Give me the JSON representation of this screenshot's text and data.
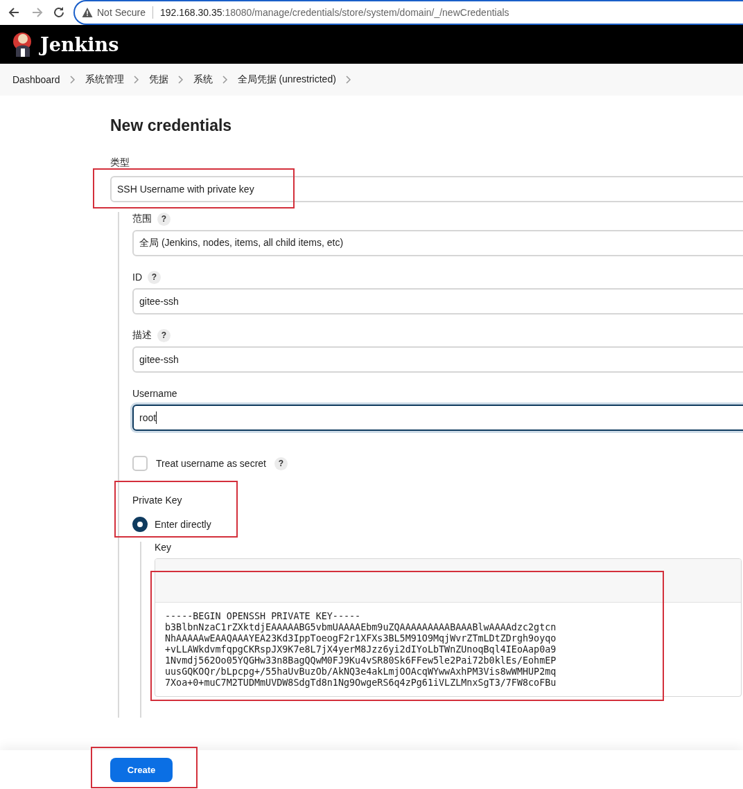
{
  "browser": {
    "security": "Not Secure",
    "url_host": "192.168.30.35",
    "url_path": ":18080/manage/credentials/store/system/domain/_/newCredentials"
  },
  "header": {
    "title": "Jenkins"
  },
  "breadcrumbs": [
    "Dashboard",
    "系统管理",
    "凭据",
    "系统",
    "全局凭据 (unrestricted)"
  ],
  "page_title": "New credentials",
  "kind_field": {
    "label": "类型",
    "value": "SSH Username with private key",
    "highlighted": true
  },
  "fields": [
    {
      "label": "范围",
      "help": "?",
      "value": "全局 (Jenkins, nodes, items, all child items, etc)",
      "focused": false
    },
    {
      "label": "ID",
      "help": "?",
      "value": "gitee-ssh",
      "focused": false
    },
    {
      "label": "描述",
      "help": "?",
      "value": "gitee-ssh",
      "focused": false
    },
    {
      "label": "Username",
      "value": "root",
      "focused": true
    }
  ],
  "secret_checkbox": {
    "label": "Treat username as secret",
    "help": "?",
    "checked": false
  },
  "private_key": {
    "label": "Private Key",
    "highlighted": true,
    "options": [
      {
        "label": "Enter directly",
        "selected": true
      }
    ],
    "key": {
      "label": "Key",
      "highlighted": true,
      "value": "-----BEGIN OPENSSH PRIVATE KEY-----\nb3BlbnNzaC1rZXktdjEAAAAABG5vbmUAAAAEbm9uZQAAAAAAAAABAAABlwAAAAdzc2gtcn\nNhAAAAAwEAAQAAAYEA23Kd3IppToeogF2r1XFXs3BL5M91O9MqjWvrZTmLDtZDrgh9oyqo\n+vLLAWkdvmfqpgCKRspJX9K7e8L7jX4yerM8Jzz6yi2dIYoLbTWnZUnoqBql4IEoAap0a9\n1Nvmdj562Oo05YQGHw33n8BagQQwM0FJ9Ku4vSR80Sk6FFew5le2Pai72b0klEs/EohmEP\nuusGQKOQr/bLpcpg+/55haUvBuzOb/AkNQ3e4akLmjOOAcqWYwwAxhPM3Vis8wWMHUP2mq\n7Xoa+0+muC7M2TUDMmUVDW8SdgTd8n1Ng9OwgeRS6q4zPg61iVLZLMnxSgT3/7FW8coFBu"
    }
  },
  "create_button": {
    "label": "Create",
    "highlighted": true
  }
}
